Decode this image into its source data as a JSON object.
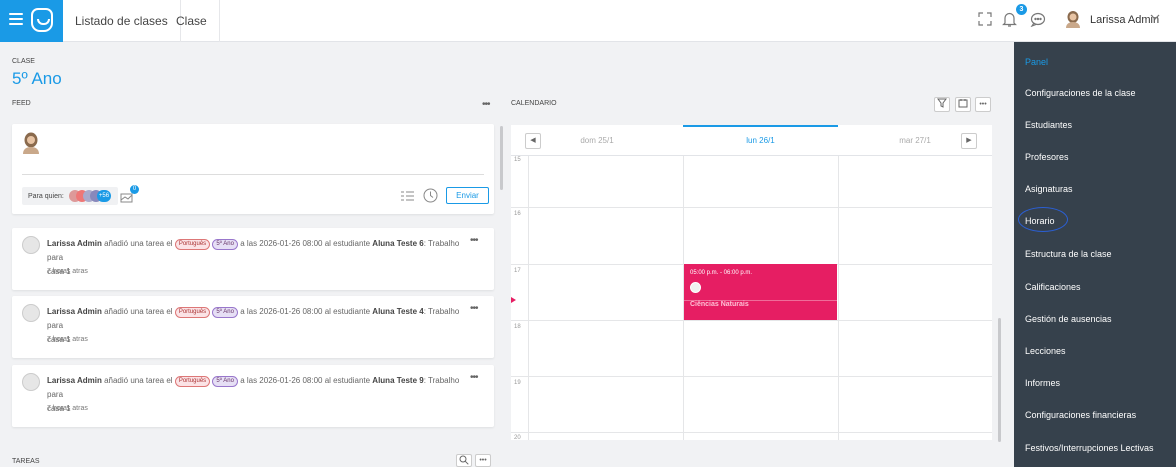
{
  "topbar": {
    "tabs": [
      "Listado de clases",
      "Clase"
    ],
    "notifications_count": "3",
    "user_name": "Larissa Admin"
  },
  "header": {
    "overline": "CLASE",
    "title": "5º Ano"
  },
  "feed": {
    "label": "FEED",
    "composer": {
      "para_quien_label": "Para quien:",
      "extra_count": "+56",
      "attach_count": "0",
      "send_label": "Enviar"
    },
    "posts": [
      {
        "author": "Larissa Admin",
        "prefix": "añadió una tarea el",
        "subject": "Português",
        "year": "5º Ano",
        "mid": "a las 2026-01-26 08:00 al estudiante",
        "student": "Aluna Teste 6",
        "rest": ": Trabalho para",
        "line2": "casa 1",
        "time": "7 horas atras"
      },
      {
        "author": "Larissa Admin",
        "prefix": "añadió una tarea el",
        "subject": "Português",
        "year": "5º Ano",
        "mid": "a las 2026-01-26 08:00 al estudiante",
        "student": "Aluna Teste 4",
        "rest": ": Trabalho para",
        "line2": "casa 1",
        "time": "7 horas atras"
      },
      {
        "author": "Larissa Admin",
        "prefix": "añadió una tarea el",
        "subject": "Português",
        "year": "5º Ano",
        "mid": "a las 2026-01-26 08:00 al estudiante",
        "student": "Aluna Teste 9",
        "rest": ": Trabalho para",
        "line2": "casa 1",
        "time": "7 horas atras"
      }
    ]
  },
  "tareas": {
    "label": "TAREAS"
  },
  "calendar": {
    "label": "CALENDARIO",
    "days": [
      "dom 25/1",
      "lun 26/1",
      "mar 27/1"
    ],
    "hours": [
      "15",
      "16",
      "17",
      "18",
      "19",
      "20"
    ],
    "event": {
      "time": "05:00 p.m. - 06:00 p.m.",
      "title": "Ciências Naturais"
    }
  },
  "sidebar": {
    "items": [
      "Panel",
      "Configuraciones de la clase",
      "Estudiantes",
      "Profesores",
      "Asignaturas",
      "Horario",
      "Estructura de la clase",
      "Calificaciones",
      "Gestión de ausencias",
      "Lecciones",
      "Informes",
      "Configuraciones financieras",
      "Festivos/Interrupciones Lectivas"
    ]
  },
  "colors": {
    "accent": "#1a9ae6",
    "sidebar": "#36414c",
    "event": "#e61e63"
  }
}
